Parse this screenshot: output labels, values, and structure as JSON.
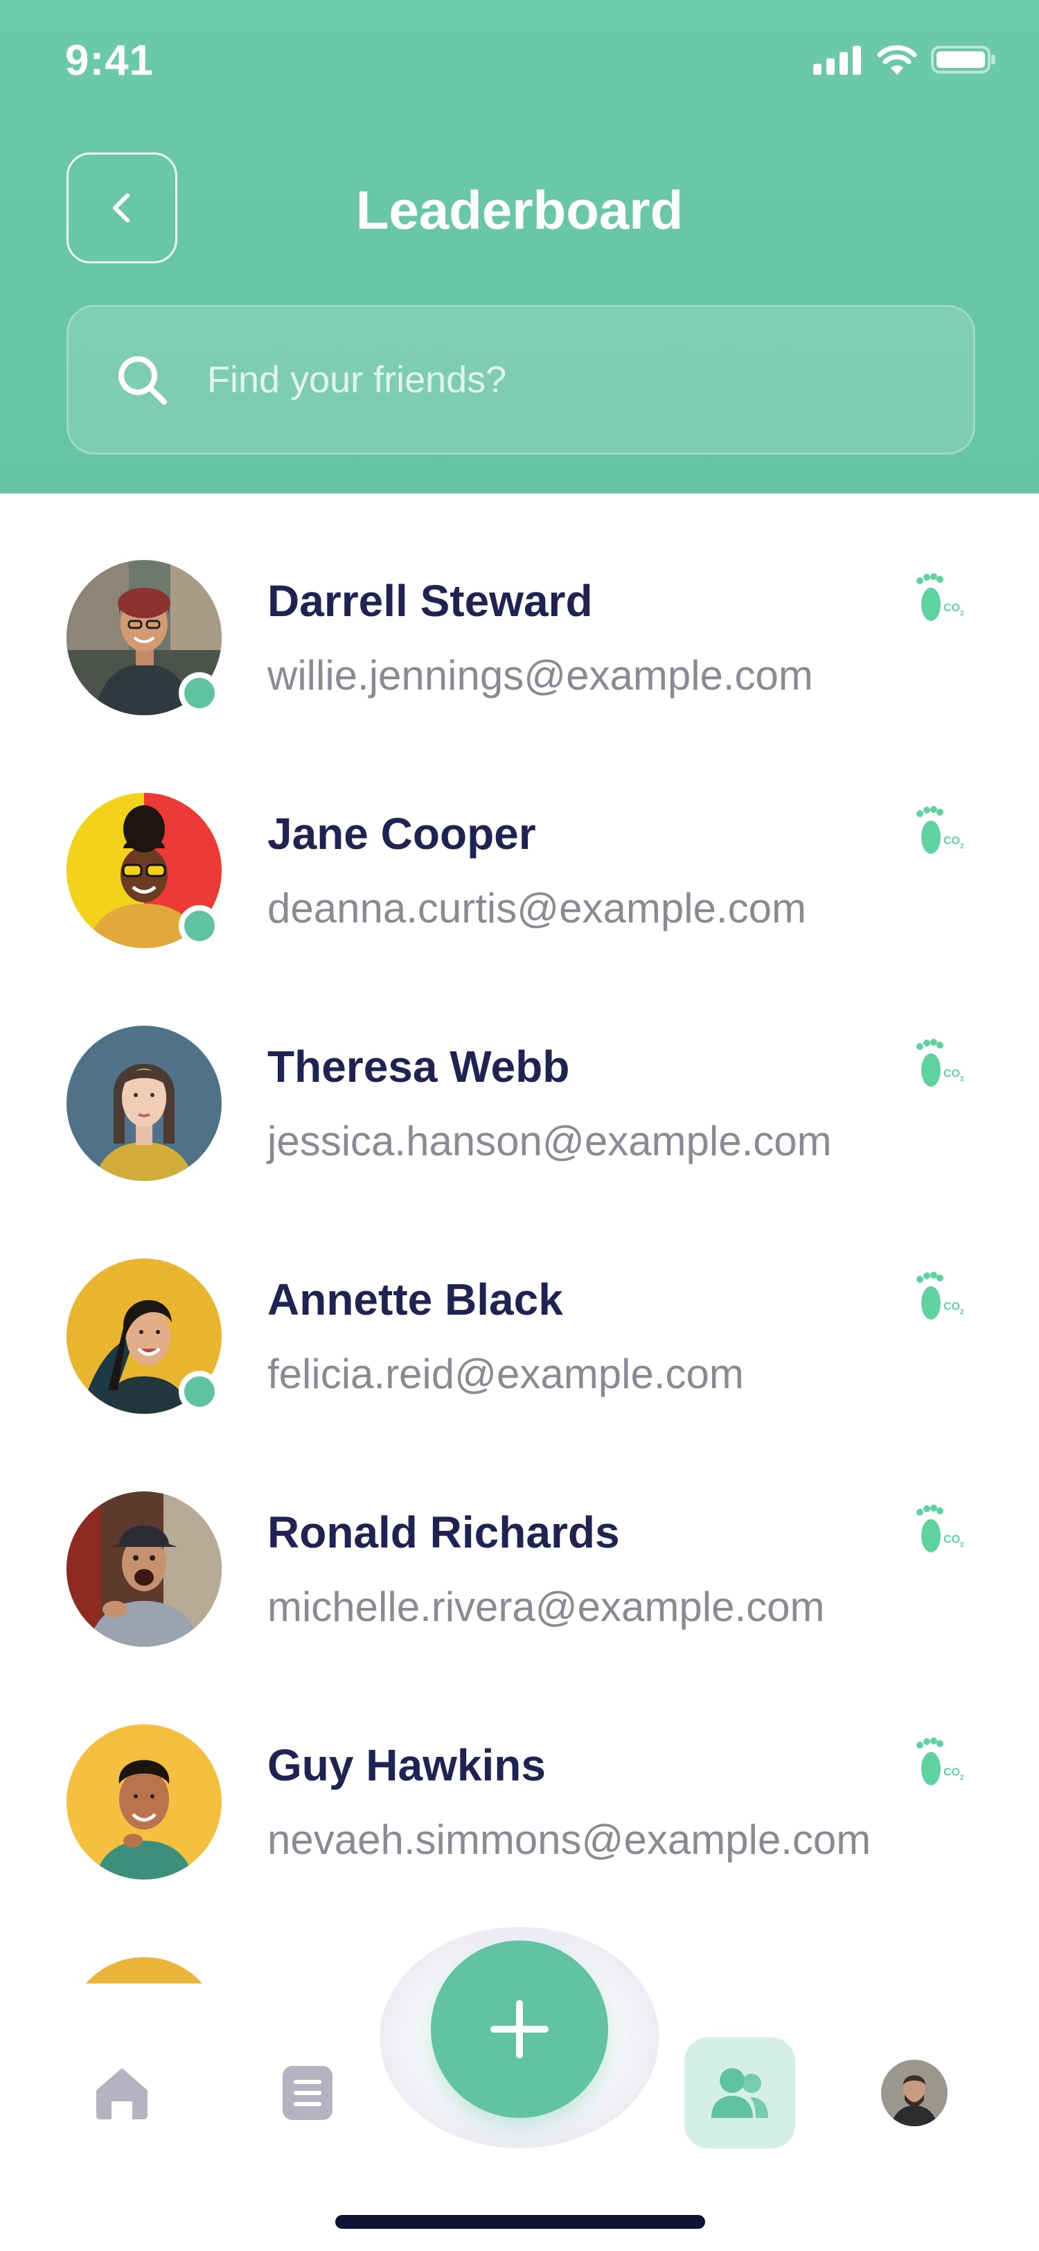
{
  "status_bar": {
    "time": "9:41"
  },
  "header": {
    "title": "Leaderboard",
    "search_placeholder": "Find your friends?"
  },
  "colors": {
    "brand": "#67c3a6",
    "name_text": "#1f2352",
    "email_text": "#8a8a92",
    "online": "#5fc2a2"
  },
  "friends": [
    {
      "name": "Darrell Steward",
      "email": "willie.jennings@example.com",
      "online": true
    },
    {
      "name": "Jane Cooper",
      "email": "deanna.curtis@example.com",
      "online": true
    },
    {
      "name": "Theresa Webb",
      "email": "jessica.hanson@example.com",
      "online": false
    },
    {
      "name": "Annette Black",
      "email": "felicia.reid@example.com",
      "online": true
    },
    {
      "name": "Ronald Richards",
      "email": "michelle.rivera@example.com",
      "online": false
    },
    {
      "name": "Guy Hawkins",
      "email": "nevaeh.simmons@example.com",
      "online": false
    }
  ],
  "icons": {
    "row_badge": "co2-footprint-icon",
    "nav": [
      "home-icon",
      "document-icon",
      "plus-icon",
      "friends-icon",
      "profile-avatar"
    ]
  }
}
